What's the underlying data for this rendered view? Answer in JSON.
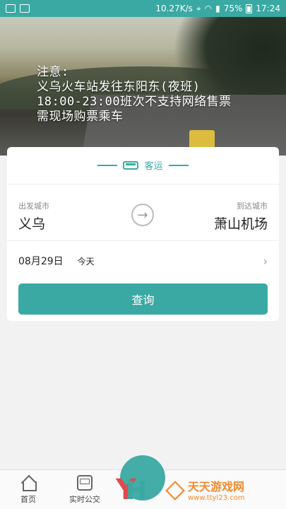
{
  "status_bar": {
    "network_speed": "10.27K/s",
    "battery": "75%",
    "time": "17:24"
  },
  "banner": {
    "notice_lines": [
      "注意:",
      "义乌火车站发往东阳东(夜班)",
      "18:00-23:00班次不支持网络售票",
      "需现场购票乘车"
    ]
  },
  "search": {
    "mode_label": "客运",
    "from_label": "出发城市",
    "from_city": "义乌",
    "to_label": "到达城市",
    "to_city": "萧山机场",
    "date": "08月29日",
    "date_hint": "今天",
    "query_button": "查询"
  },
  "bottom_nav": {
    "items": [
      {
        "label": "首页",
        "icon": "home-icon"
      },
      {
        "label": "实时公交",
        "icon": "bus-icon"
      }
    ]
  },
  "watermark": {
    "title": "天天游戏网",
    "url": "www.ttyl23.com"
  },
  "colors": {
    "accent": "#3aa9a3",
    "watermark": "#f08a2c"
  }
}
